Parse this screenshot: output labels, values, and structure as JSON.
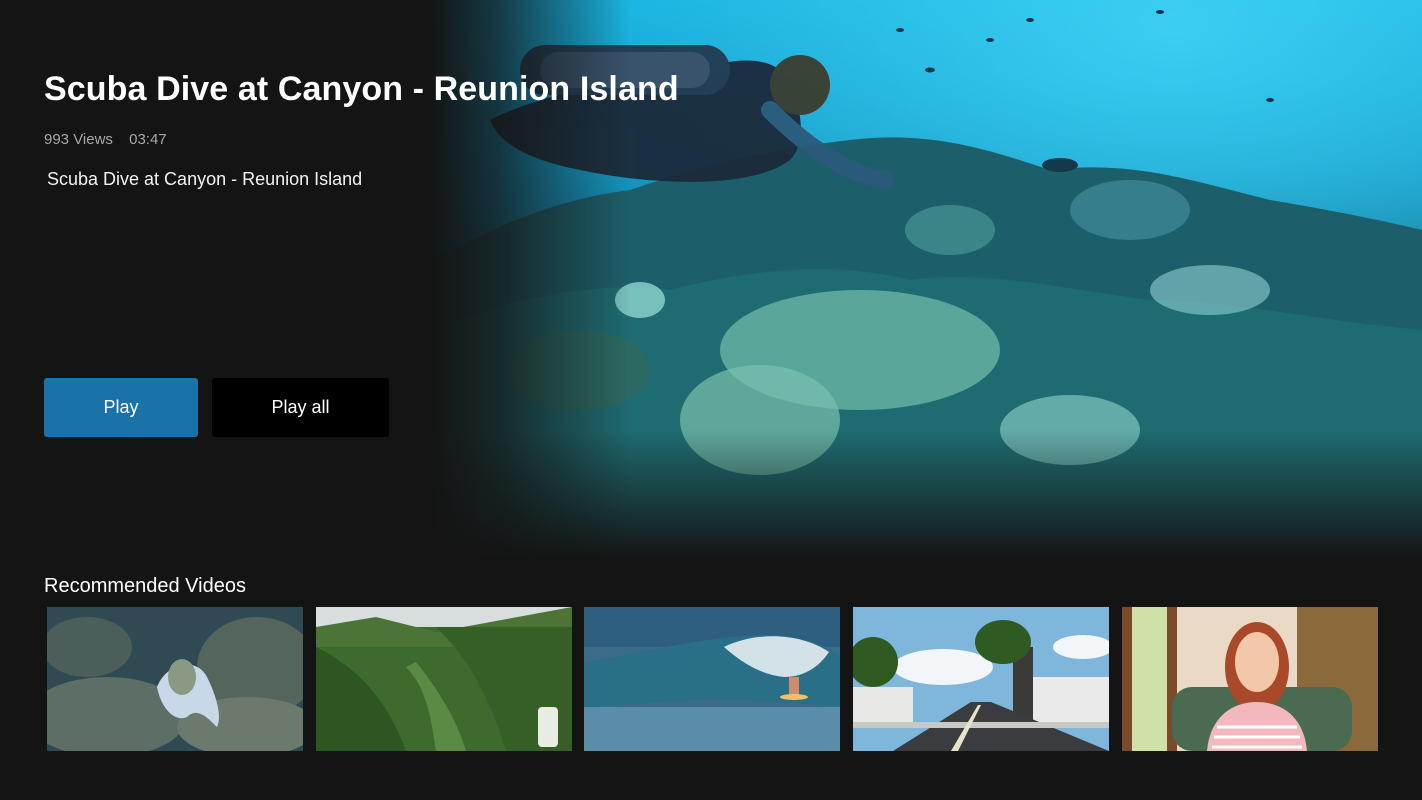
{
  "hero": {
    "title": "Scuba Dive at Canyon - Reunion Island",
    "views": "993 Views",
    "duration": "03:47",
    "description": "Scuba Dive at Canyon - Reunion Island",
    "play_label": "Play",
    "play_all_label": "Play all"
  },
  "recommended": {
    "title": "Recommended Videos",
    "items": [
      {
        "thumbnail": "octopus-reef-thumbnail"
      },
      {
        "thumbnail": "green-mountain-valley-thumbnail"
      },
      {
        "thumbnail": "surfer-wave-thumbnail"
      },
      {
        "thumbnail": "palm-street-thumbnail"
      },
      {
        "thumbnail": "woman-interview-thumbnail"
      }
    ]
  },
  "colors": {
    "background": "#141414",
    "play_button": "#1a72aa",
    "play_all_button": "#000000",
    "meta_text": "#a8a8a8"
  }
}
